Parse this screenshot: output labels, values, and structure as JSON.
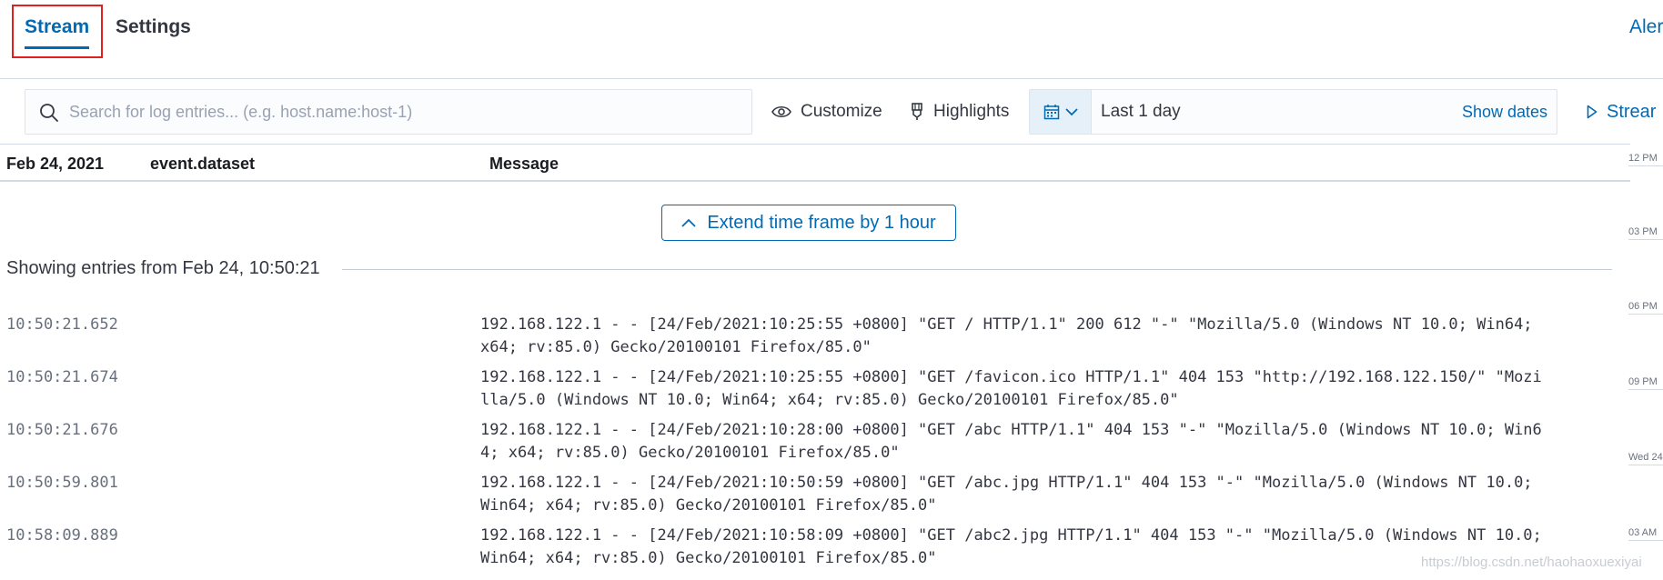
{
  "tabs": {
    "stream": "Stream",
    "settings": "Settings",
    "alerts": "Aler"
  },
  "toolbar": {
    "search_placeholder": "Search for log entries... (e.g. host.name:host-1)",
    "customize_label": "Customize",
    "highlights_label": "Highlights",
    "date_range": "Last 1 day",
    "show_dates_label": "Show dates",
    "stream_live_label": "Strear"
  },
  "columns": {
    "date": "Feb 24, 2021",
    "dataset": "event.dataset",
    "message": "Message"
  },
  "extend_label": "Extend time frame by 1 hour",
  "showing_text": "Showing entries from Feb 24, 10:50:21",
  "log_entries": [
    {
      "time": "10:50:21.652",
      "message": "192.168.122.1 - - [24/Feb/2021:10:25:55 +0800] \"GET / HTTP/1.1\" 200 612 \"-\" \"Mozilla/5.0 (Windows NT 10.0; Win64; x64; rv:85.0) Gecko/20100101 Firefox/85.0\""
    },
    {
      "time": "10:50:21.674",
      "message": "192.168.122.1 - - [24/Feb/2021:10:25:55 +0800] \"GET /favicon.ico HTTP/1.1\" 404 153 \"http://192.168.122.150/\" \"Mozilla/5.0 (Windows NT 10.0; Win64; x64; rv:85.0) Gecko/20100101 Firefox/85.0\""
    },
    {
      "time": "10:50:21.676",
      "message": "192.168.122.1 - - [24/Feb/2021:10:28:00 +0800] \"GET /abc HTTP/1.1\" 404 153 \"-\" \"Mozilla/5.0 (Windows NT 10.0; Win64; x64; rv:85.0) Gecko/20100101 Firefox/85.0\""
    },
    {
      "time": "10:50:59.801",
      "message": "192.168.122.1 - - [24/Feb/2021:10:50:59 +0800] \"GET /abc.jpg HTTP/1.1\" 404 153 \"-\" \"Mozilla/5.0 (Windows NT 10.0; Win64; x64; rv:85.0) Gecko/20100101 Firefox/85.0\""
    },
    {
      "time": "10:58:09.889",
      "message": "192.168.122.1 - - [24/Feb/2021:10:58:09 +0800] \"GET /abc2.jpg HTTP/1.1\" 404 153 \"-\" \"Mozilla/5.0 (Windows NT 10.0; Win64; x64; rv:85.0) Gecko/20100101 Firefox/85.0\""
    }
  ],
  "minimap_ticks": [
    "12 PM",
    "03 PM",
    "06 PM",
    "09 PM",
    "Wed 24",
    "03 AM"
  ],
  "watermark": "https://blog.csdn.net/haohaoxuexiyai",
  "colors": {
    "accent": "#006bb4",
    "highlight_box": "#e0201e",
    "border": "#d3dae6"
  },
  "icons": {
    "search": "search-icon",
    "customize": "eye-icon",
    "highlights": "highlighter-icon",
    "calendar": "calendar-icon",
    "quick_menu": "chevron-down-icon",
    "extend": "chevron-up-icon",
    "stream_live": "play-icon"
  }
}
